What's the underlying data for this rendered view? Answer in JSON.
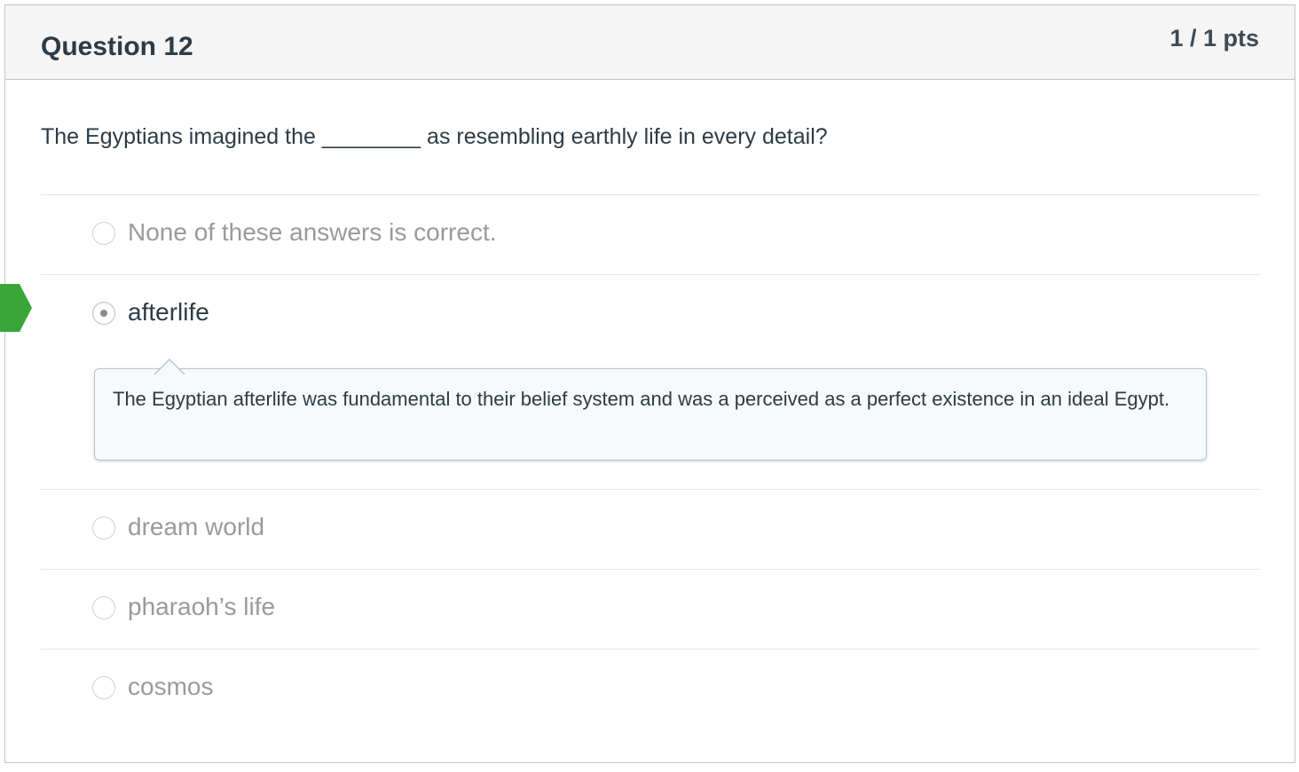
{
  "question": {
    "title": "Question 12",
    "points": "1 / 1 pts",
    "text": "The Egyptians imagined the ________ as resembling earthly life in every detail?"
  },
  "answers": [
    {
      "label": "None of these answers is correct.",
      "selected": false
    },
    {
      "label": "afterlife",
      "selected": true,
      "correct": true,
      "feedback": "The Egyptian afterlife was fundamental to their belief system and was a perceived as a perfect existence in an ideal Egypt."
    },
    {
      "label": "dream world",
      "selected": false
    },
    {
      "label": "pharaoh’s life",
      "selected": false
    },
    {
      "label": "cosmos",
      "selected": false
    }
  ],
  "colors": {
    "correct_marker": "#3aa63a",
    "header_bg": "#f5f5f5",
    "unselected_text": "#9a9a9a"
  },
  "icons": {
    "correct_marker": "correct-answer-arrow-icon"
  }
}
